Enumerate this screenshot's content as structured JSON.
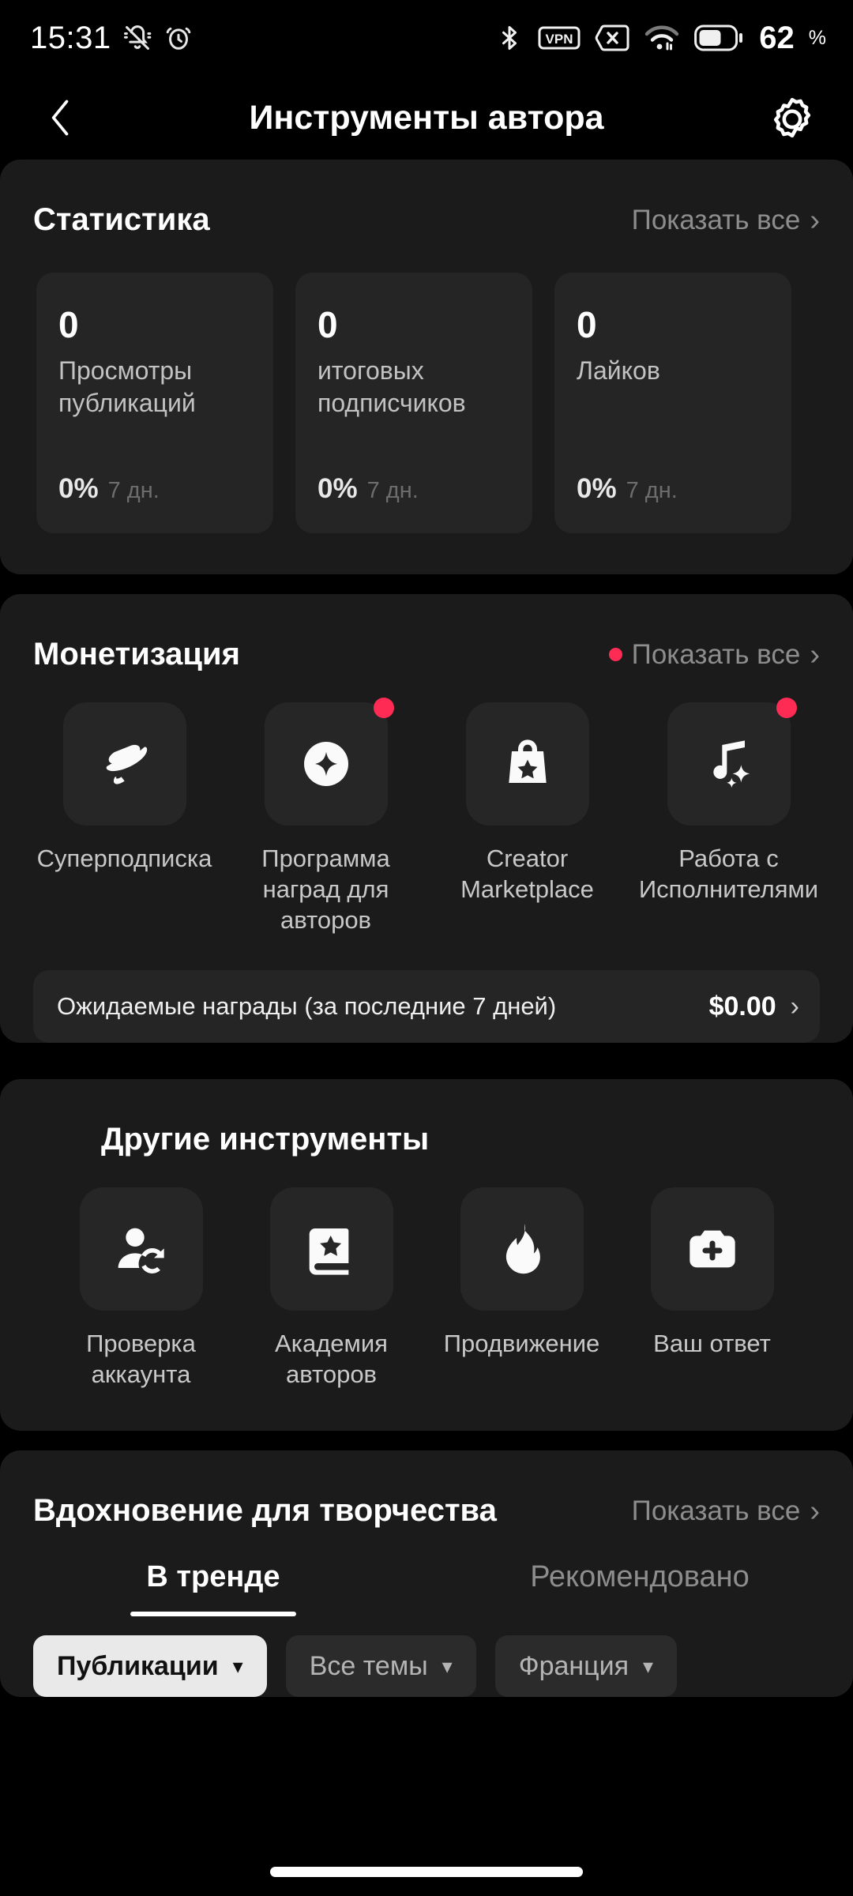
{
  "status_bar": {
    "time": "15:31",
    "left_icons": [
      "mute-bell-icon",
      "alarm-clock-icon"
    ],
    "right_icons": [
      "bluetooth-icon",
      "vpn-icon",
      "sim-off-icon",
      "wifi-icon",
      "battery-icon"
    ],
    "vpn_label": "VPN",
    "battery_level": "62",
    "battery_percent_symbol": "%"
  },
  "nav": {
    "back_icon": "chevron-left-icon",
    "title": "Инструменты автора",
    "settings_icon": "gear-icon"
  },
  "statistics": {
    "title": "Статистика",
    "show_all": "Показать все",
    "cards": [
      {
        "value": "0",
        "label": "Просмотры публикаций",
        "delta": "0%",
        "period": "7 дн."
      },
      {
        "value": "0",
        "label": "итоговых подписчиков",
        "delta": "0%",
        "period": "7 дн."
      },
      {
        "value": "0",
        "label": "Лайков",
        "delta": "0%",
        "period": "7 дн."
      }
    ]
  },
  "monetization": {
    "title": "Монетизация",
    "show_all": "Показать все",
    "has_badge": true,
    "items": [
      {
        "label": "Суперподписка",
        "icon": "planet-icon",
        "badge": false
      },
      {
        "label": "Программа наград для авторов",
        "icon": "star-circle-icon",
        "badge": true
      },
      {
        "label": "Creator Marketplace",
        "icon": "shopping-bag-star-icon",
        "badge": false
      },
      {
        "label": "Работа с Исполнителями",
        "icon": "music-note-sparkle-icon",
        "badge": true
      }
    ],
    "rewards_label": "Ожидаемые награды (за последние 7 дней)",
    "rewards_amount": "$0.00",
    "rewards_chevron": "chevron-right-icon"
  },
  "other_tools": {
    "title": "Другие инструменты",
    "items": [
      {
        "label": "Проверка аккаунта",
        "icon": "person-refresh-icon"
      },
      {
        "label": "Академия авторов",
        "icon": "book-star-icon"
      },
      {
        "label": "Продвижение",
        "icon": "flame-icon"
      },
      {
        "label": "Ваш ответ",
        "icon": "camera-plus-icon"
      }
    ]
  },
  "inspiration": {
    "title": "Вдохновение для творчества",
    "show_all": "Показать все",
    "tabs": [
      {
        "label": "В тренде",
        "active": true
      },
      {
        "label": "Рекомендовано",
        "active": false
      }
    ],
    "chips": [
      {
        "label": "Публикации",
        "active": true,
        "caret": "chevron-down-icon"
      },
      {
        "label": "Все темы",
        "active": false,
        "caret": "chevron-down-icon"
      },
      {
        "label": "Франция",
        "active": false,
        "caret": "chevron-down-icon"
      }
    ]
  },
  "colors": {
    "background": "#000000",
    "panel": "#1b1b1b",
    "card": "#252525",
    "tile": "#262626",
    "accent_red": "#fe2c55",
    "text_primary": "#ffffff",
    "text_secondary": "#8d8d8d",
    "chip_active_bg": "#e9e9e9"
  }
}
